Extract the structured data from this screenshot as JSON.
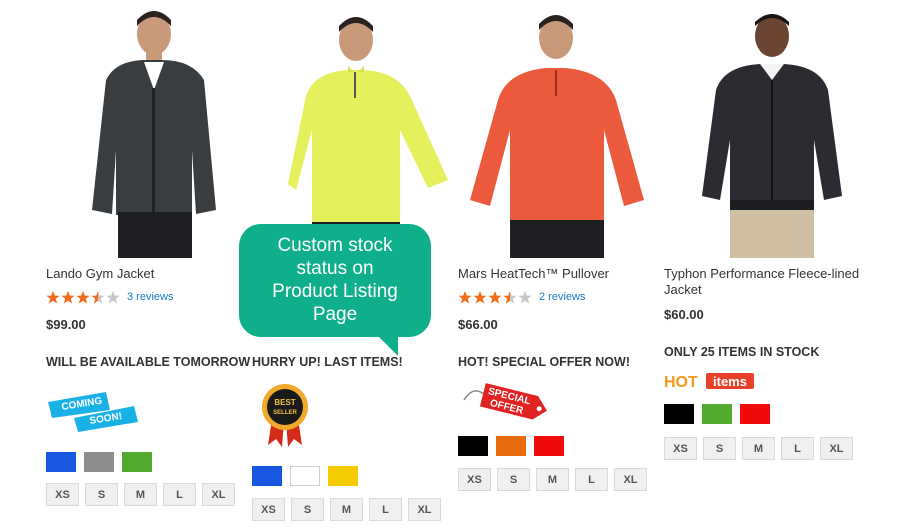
{
  "products": [
    {
      "name": "Lando Gym Jacket",
      "rating_value": 3.5,
      "reviews": "3 reviews",
      "price": "$99.00",
      "stock_status": "WILL BE AVAILABLE TOMORROW",
      "badge_text": [
        "COMING",
        "SOON!"
      ],
      "colors": [
        "#1857e0",
        "#8e8e8e",
        "#53a82e"
      ],
      "sizes": [
        "XS",
        "S",
        "M",
        "L",
        "XL"
      ],
      "shirt_color": "#3a3d40"
    },
    {
      "name": "",
      "price": "",
      "stock_status": "HURRY UP! LAST ITEMS!",
      "badge_text": [
        "BEST",
        "SELLER"
      ],
      "colors": [
        "#1857e0",
        "#ffffff",
        "#f5cc00"
      ],
      "sizes": [
        "XS",
        "S",
        "M",
        "L",
        "XL"
      ],
      "shirt_color": "#e6ef5c"
    },
    {
      "name": "Mars HeatTech™ Pullover",
      "rating_value": 3.5,
      "reviews": "2 reviews",
      "price": "$66.00",
      "stock_status": "HOT! SPECIAL OFFER NOW!",
      "badge_text": [
        "SPECIAL",
        "OFFER"
      ],
      "colors": [
        "#000000",
        "#e86b10",
        "#f00a0a"
      ],
      "sizes": [
        "XS",
        "S",
        "M",
        "L",
        "XL"
      ],
      "shirt_color": "#ec5a3e"
    },
    {
      "name": "Typhon Performance Fleece-lined Jacket",
      "price": "$60.00",
      "stock_status": "ONLY 25 ITEMS IN STOCK",
      "badge_text": [
        "HOT",
        "items"
      ],
      "colors": [
        "#000000",
        "#53a82e",
        "#f00a0a"
      ],
      "sizes": [
        "XS",
        "S",
        "M",
        "L",
        "XL"
      ],
      "shirt_color": "#2a2c31"
    }
  ],
  "callout": {
    "text": "Custom stock\nstatus on\nProduct Listing\nPage",
    "color": "#0faf8c"
  },
  "colors": {
    "star_filled": "#f26c1e",
    "star_empty": "#c8c8c8",
    "link": "#1979c3"
  }
}
